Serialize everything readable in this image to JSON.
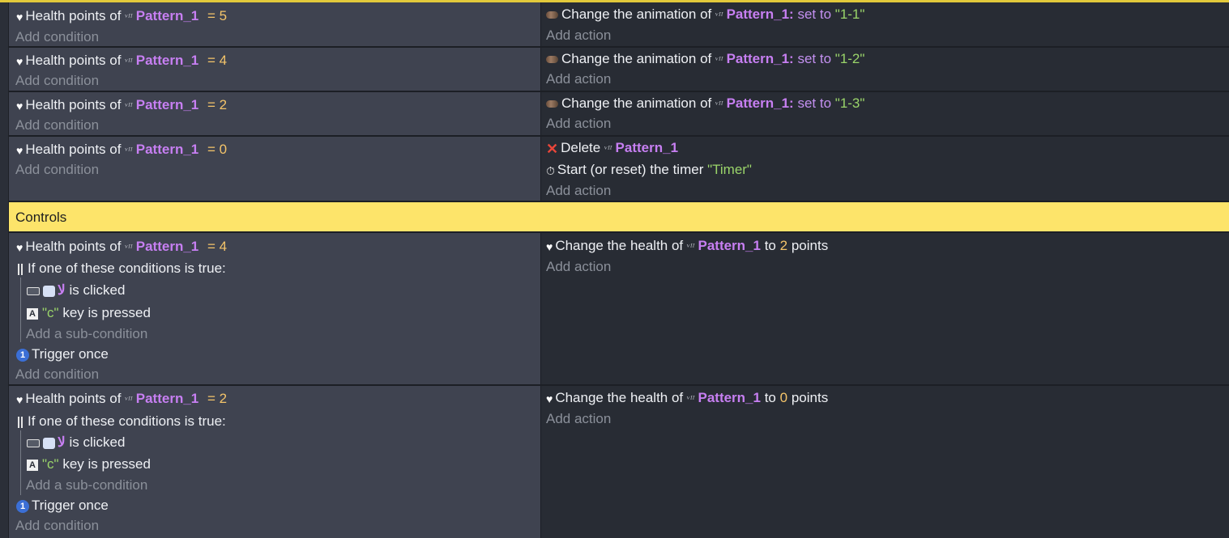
{
  "icons": {
    "health": "heart-icon",
    "object": "object-sprite-icon",
    "animation": "animation-icon",
    "delete": "delete-x-icon",
    "timer": "stopwatch-icon",
    "or": "or-bars-icon",
    "mouse": "mouse-icon",
    "button": "button-object-icon",
    "key": "keyboard-key-icon",
    "once": "trigger-once-icon"
  },
  "colors": {
    "group_bar": "#fde46a",
    "object_name": "#c77ff2",
    "number": "#f4c46a",
    "string": "#9ad46a",
    "delete_icon": "#e8463a"
  },
  "labels": {
    "add_condition": "Add condition",
    "add_action": "Add action",
    "add_subcondition": "Add a sub-condition",
    "health_points_of": "Health points of",
    "eq": "=",
    "change_animation_of": "Change the animation of",
    "set_to": "set to",
    "colon": ":",
    "delete": "Delete",
    "start_timer": "Start (or reset) the timer",
    "or_header": "If one of these conditions is true:",
    "is_clicked": "is clicked",
    "key_pressed": "key is pressed",
    "trigger_once": "Trigger once",
    "change_health_of": "Change the health of",
    "to": "to",
    "points": "points",
    "object_glyph": "ᵛᴵᴵ",
    "key_letter": "A",
    "once_glyph": "1"
  },
  "events": [
    {
      "object": "Pattern_1",
      "value": "5",
      "action_object": "Pattern_1",
      "animation": "\"1-1\""
    },
    {
      "object": "Pattern_1",
      "value": "4",
      "action_object": "Pattern_1",
      "animation": "\"1-2\""
    },
    {
      "object": "Pattern_1",
      "value": "2",
      "action_object": "Pattern_1",
      "animation": "\"1-3\""
    },
    {
      "object": "Pattern_1",
      "value": "0",
      "delete_object": "Pattern_1",
      "timer_name": "\"Timer\""
    }
  ],
  "group": {
    "title": "Controls"
  },
  "controls": [
    {
      "object": "Pattern_1",
      "value": "4",
      "button_name": "لا",
      "key": "\"c\"",
      "action_object": "Pattern_1",
      "health_value": "2"
    },
    {
      "object": "Pattern_1",
      "value": "2",
      "button_name": "لا",
      "key": "\"c\"",
      "action_object": "Pattern_1",
      "health_value": "0"
    }
  ]
}
